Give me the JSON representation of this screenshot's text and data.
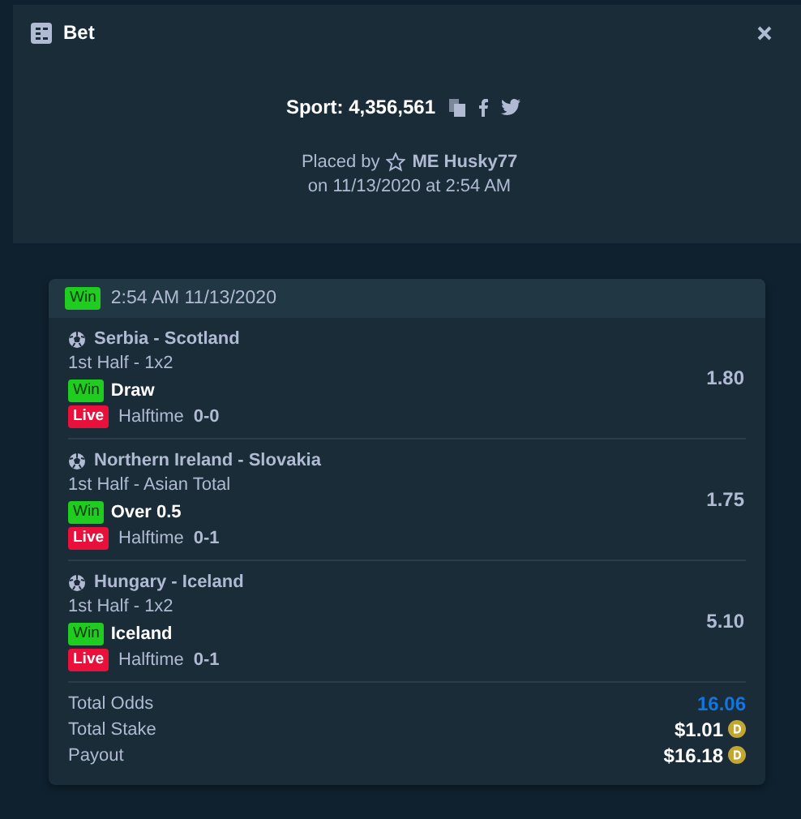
{
  "modal": {
    "title": "Bet",
    "sport_label": "Sport: 4,356,561",
    "placed_by": "Placed by",
    "user": "ME Husky77",
    "placed_on": "on 11/13/2020 at 2:54 AM"
  },
  "bet": {
    "status": {
      "label": "Win",
      "kind": "win"
    },
    "time": "2:54 AM 11/13/2020",
    "legs": [
      {
        "match": "Serbia - Scotland",
        "market": "1st Half - 1x2",
        "result": {
          "label": "Win",
          "kind": "win"
        },
        "pick": "Draw",
        "state": {
          "label": "Live",
          "kind": "live"
        },
        "period": "Halftime",
        "score": "0-0",
        "odds": "1.80"
      },
      {
        "match": "Northern Ireland - Slovakia",
        "market": "1st Half - Asian Total",
        "result": {
          "label": "Win",
          "kind": "win"
        },
        "pick": "Over 0.5",
        "state": {
          "label": "Live",
          "kind": "live"
        },
        "period": "Halftime",
        "score": "0-1",
        "odds": "1.75"
      },
      {
        "match": "Hungary - Iceland",
        "market": "1st Half - 1x2",
        "result": {
          "label": "Win",
          "kind": "win"
        },
        "pick": "Iceland",
        "state": {
          "label": "Live",
          "kind": "live"
        },
        "period": "Halftime",
        "score": "0-1",
        "odds": "5.10"
      }
    ],
    "totals": [
      {
        "label": "Total Odds",
        "value": "16.06",
        "kind": "odds"
      },
      {
        "label": "Total Stake",
        "value": "$1.01",
        "kind": "coin"
      },
      {
        "label": "Payout",
        "value": "$16.18",
        "kind": "coin"
      }
    ]
  }
}
